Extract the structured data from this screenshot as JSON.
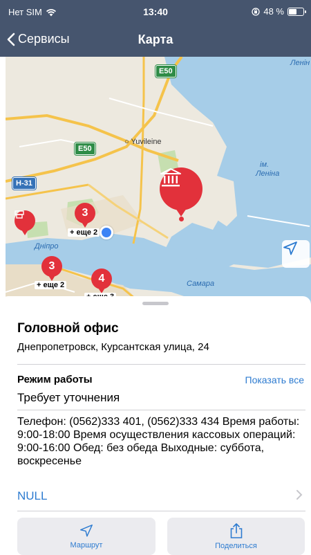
{
  "status_bar": {
    "carrier": "Нет SIM",
    "time": "13:40",
    "battery_percent": "48 %",
    "battery_level": 0.48,
    "icons": [
      "wifi-icon",
      "orientation-lock-icon",
      "battery-icon"
    ]
  },
  "nav": {
    "back_label": "Сервисы",
    "title": "Карта"
  },
  "map": {
    "places": [
      "Yuvileine",
      "Дніпро",
      "Самара"
    ],
    "water_labels": [
      "ім.",
      "Леніна",
      "Ленін"
    ],
    "road_shields": [
      "E50",
      "E50",
      "H-31"
    ],
    "clusters": [
      {
        "count": "3",
        "more": "+ еще 2"
      },
      {
        "count": "3",
        "more": "+ еще 2"
      },
      {
        "count": "4",
        "more": "+ еще 3"
      }
    ],
    "selected_icon": "bank-icon",
    "colors": {
      "pin": "#e2313b",
      "user_dot": "#3d84f5",
      "water": "#a6cde8"
    }
  },
  "branch": {
    "title": "Головной офис",
    "address": "Днепропетровск, Курсантская улица, 24",
    "hours_title": "Режим работы",
    "show_all": "Показать все",
    "hours_value": "Требует уточнения",
    "details": "Телефон: (0562)333 401, (0562)333 434  Время работы: 9:00-18:00  Время осуществления кассовых операций: 9:00-16:00  Обед: без обеда  Выходные: суббота, воскресенье",
    "link_text": "NULL"
  },
  "actions": {
    "route_label": "Маршрут",
    "share_label": "Поделиться"
  },
  "colors": {
    "nav_bg": "#46556e",
    "accent": "#2d7bd0"
  }
}
